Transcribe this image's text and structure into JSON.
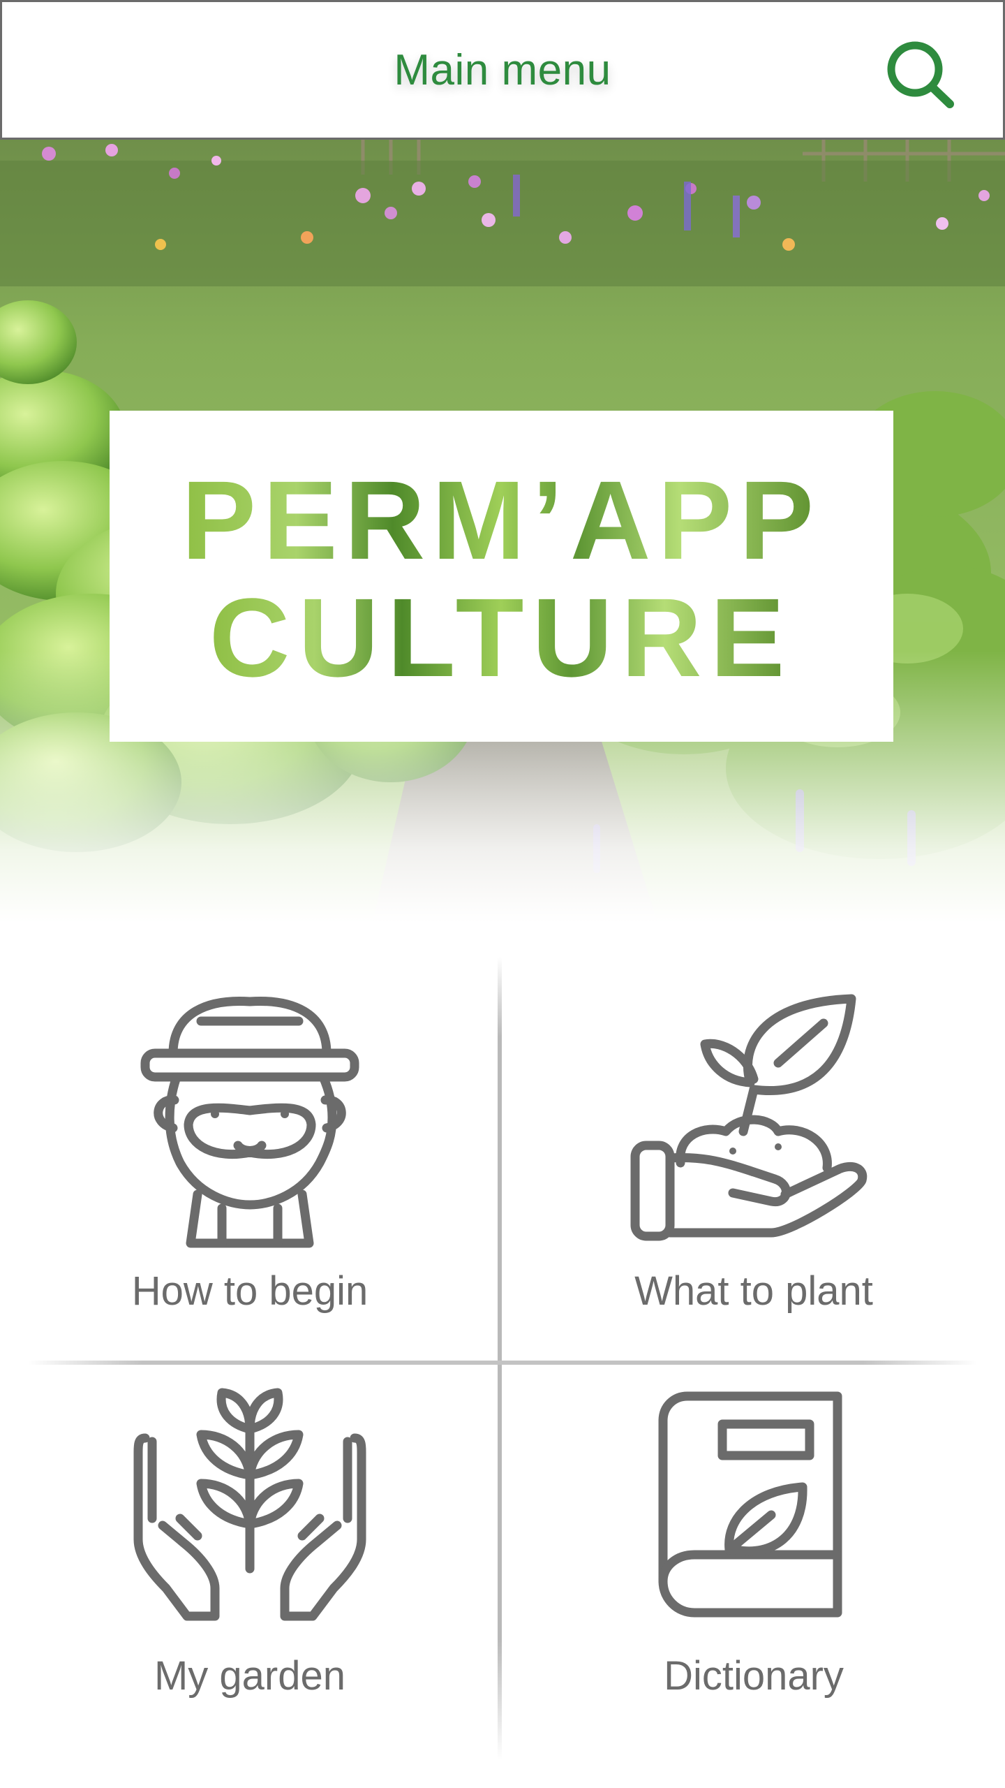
{
  "header": {
    "title": "Main menu",
    "search_icon": "search-icon",
    "accent_color": "#2e8b3e"
  },
  "hero": {
    "logo_line1": "PERM’APP",
    "logo_line2": "CULTURE"
  },
  "menu": {
    "items": [
      {
        "label": "How to begin",
        "icon": "gardener-icon"
      },
      {
        "label": "What to plant",
        "icon": "hand-sprout-icon"
      },
      {
        "label": "My garden",
        "icon": "hands-plant-icon"
      },
      {
        "label": "Dictionary",
        "icon": "book-leaf-icon"
      }
    ],
    "text_color": "#6b6b6b"
  }
}
